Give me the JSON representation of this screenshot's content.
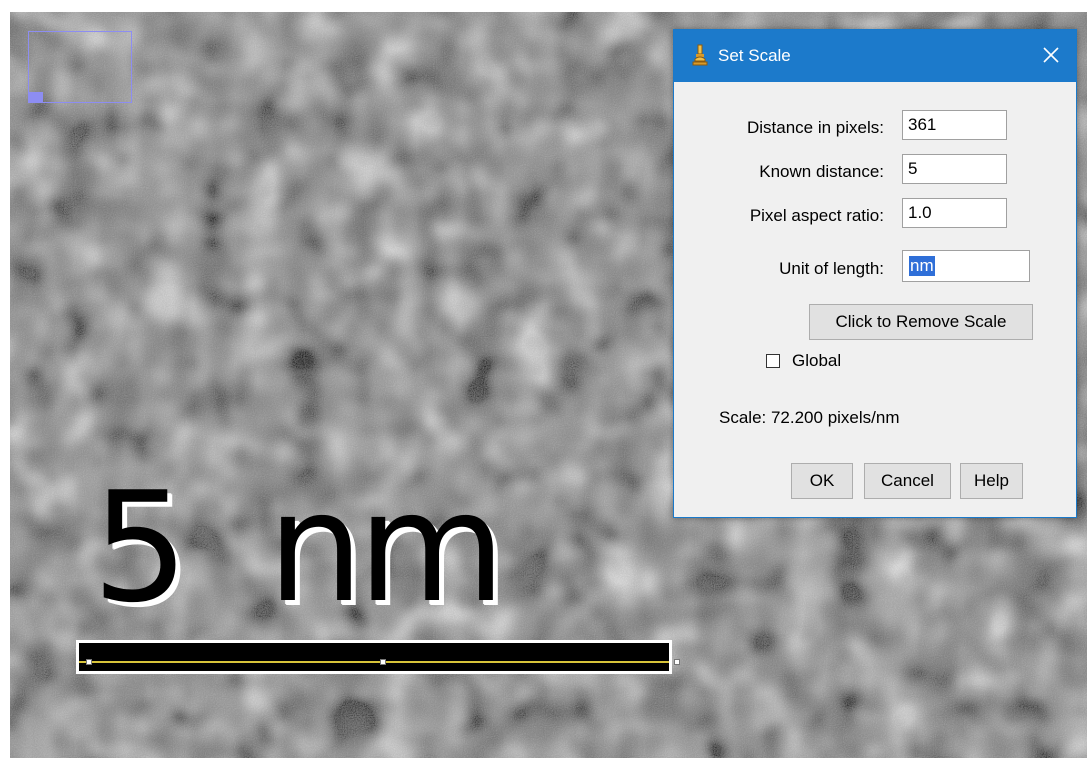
{
  "image": {
    "scale_label": "5  nm"
  },
  "dialog": {
    "title": "Set Scale",
    "fields": [
      {
        "label": "Distance in pixels:",
        "value": "361"
      },
      {
        "label": "Known distance:",
        "value": "5"
      },
      {
        "label": "Pixel aspect ratio:",
        "value": "1.0"
      },
      {
        "label": "Unit of length:",
        "value": "nm"
      }
    ],
    "remove_scale_button": "Click to Remove Scale",
    "global_label": "Global",
    "global_checked": false,
    "scale_info": "Scale: 72.200 pixels/nm",
    "buttons": {
      "ok": "OK",
      "cancel": "Cancel",
      "help": "Help"
    }
  },
  "icons": {
    "title_icon": "microscope-icon",
    "close_icon": "close-icon"
  },
  "colors": {
    "titlebar": "#1c7acb",
    "selection": "#2f6fd8",
    "scale_line": "#d8c43a",
    "navigator": "#8d8df2"
  }
}
